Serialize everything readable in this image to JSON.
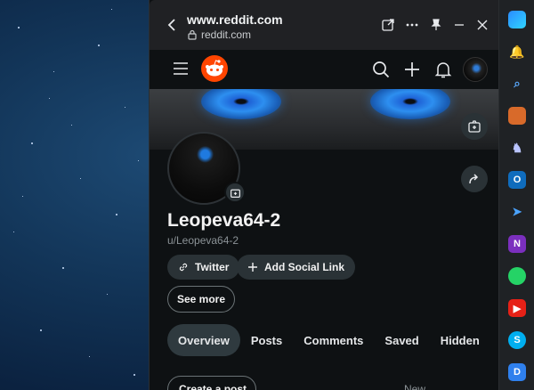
{
  "browser": {
    "title": "www.reddit.com",
    "url": "reddit.com"
  },
  "profile": {
    "display_name": "Leopeva64-2",
    "username": "u/Leopeva64-2",
    "social_links": [
      {
        "label": "Twitter",
        "icon": "link-icon"
      },
      {
        "label": "Add Social Link",
        "icon": "plus-icon"
      }
    ],
    "see_more_label": "See more"
  },
  "tabs": [
    {
      "label": "Overview",
      "active": true
    },
    {
      "label": "Posts",
      "active": false
    },
    {
      "label": "Comments",
      "active": false
    },
    {
      "label": "Saved",
      "active": false
    },
    {
      "label": "Hidden",
      "active": false
    }
  ],
  "feed": {
    "create_post_label": "Create a post",
    "sort_label": "New"
  },
  "colors": {
    "reddit_orange": "#ff4500",
    "active_tab_bg": "#2f3a3f",
    "eye_blue": "#2d8ff0"
  },
  "taskbar_icons": [
    "copilot-icon",
    "notification-bell-icon",
    "search-icon",
    "toolbox-icon",
    "chess-icon",
    "outlook-icon",
    "telegram-icon",
    "onenote-icon",
    "whatsapp-icon",
    "youtube-icon",
    "skype-icon",
    "discord-icon"
  ]
}
